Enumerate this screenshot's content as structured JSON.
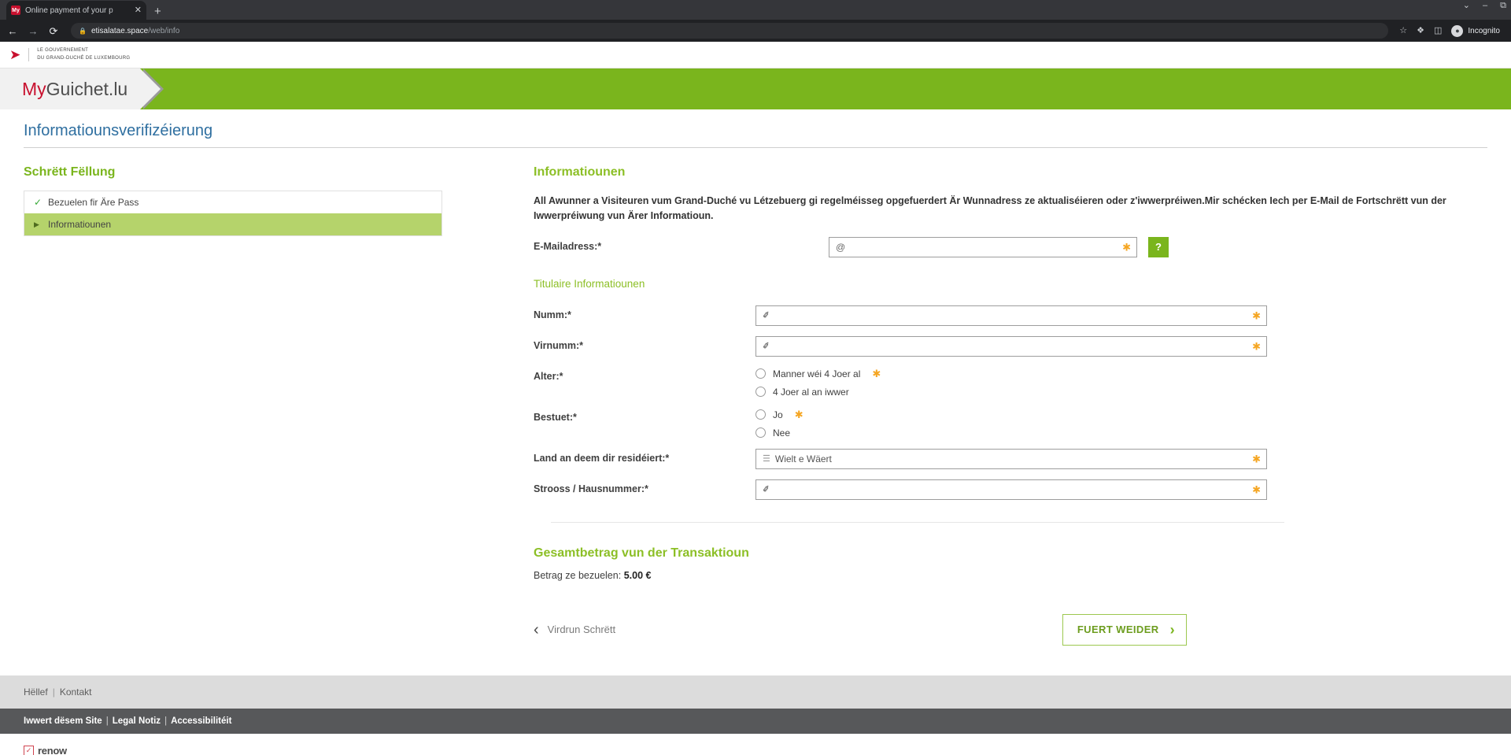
{
  "browser": {
    "tab_title": "Online payment of your p",
    "favicon_label": "My",
    "close_label": "✕",
    "new_tab_label": "+",
    "back_label": "←",
    "forward_label": "→",
    "reload_label": "⟳",
    "lock_label": "ὑ2",
    "url_domain": "etisalatae.space",
    "url_path": "/web/info",
    "star_label": "☆",
    "extensions_label": "❖",
    "sidepanel_label": "◫",
    "incognito_label": "Incognito",
    "incognito_avatar_label": "●",
    "minimize_label": "–",
    "maximize_label": "⧉",
    "chevron_label": "⌄"
  },
  "gov": {
    "line1": "LE GOUVERNEMENT",
    "line2": "DU GRAND-DUCHÉ DE LUXEMBOURG",
    "lion_label": "➤"
  },
  "brand": {
    "prefix": "My",
    "suffix": "Guichet.lu"
  },
  "page": {
    "title": "Informatiounsverifizéierung"
  },
  "steps_panel": {
    "heading": "Schrëtt Fëllung",
    "items": [
      {
        "label": "Bezuelen fir Äre Pass",
        "mark": "✓",
        "state": "done"
      },
      {
        "label": "Informatiounen",
        "mark": "▶",
        "state": "current"
      }
    ]
  },
  "main": {
    "heading": "Informatiounen",
    "intro": "All Awunner a Visiteuren vum Grand-Duché vu Létzebuerg gi regelméisseg opgefuerdert Är Wunnadress ze aktualiséieren oder z'iwwerpréiwen.Mir schécken Iech per E-Mail de Fortschrëtt vun der Iwwerpréiwung vun Ärer Informatioun.",
    "email": {
      "label": "E-Mailadress:*",
      "value": "",
      "placeholder": "",
      "icon": "at-icon",
      "icon_glyph": "@",
      "required_star": "✱",
      "help_label": "?"
    },
    "titulaire_heading": "Titulaire Informatiounen",
    "fields": [
      {
        "name": "numm",
        "label": "Numm:*",
        "type": "text",
        "value": "",
        "icon": "pencil-icon",
        "icon_glyph": "✐",
        "required_star": "✱"
      },
      {
        "name": "virnumm",
        "label": "Virnumm:*",
        "type": "text",
        "value": "",
        "icon": "pencil-icon",
        "icon_glyph": "✐",
        "required_star": "✱"
      },
      {
        "name": "alter",
        "label": "Alter:*",
        "type": "radio",
        "required_star": "✱",
        "options": [
          {
            "label": "Manner wéi 4 Joer al",
            "selected": false,
            "star": "✱"
          },
          {
            "label": "4 Joer al an iwwer",
            "selected": false,
            "star": ""
          }
        ]
      },
      {
        "name": "bestuet",
        "label": "Bestuet:*",
        "type": "radio",
        "required_star": "✱",
        "options": [
          {
            "label": "Jo",
            "selected": false,
            "star": "✱"
          },
          {
            "label": "Nee",
            "selected": false,
            "star": ""
          }
        ]
      },
      {
        "name": "land",
        "label": "Land an deem dir residéiert:*",
        "type": "select",
        "value": "Wielt e Wäert",
        "icon": "list-icon",
        "icon_glyph": "☰",
        "required_star": "✱"
      },
      {
        "name": "strooss",
        "label": "Strooss / Hausnummer:*",
        "type": "text",
        "value": "",
        "icon": "pencil-icon",
        "icon_glyph": "✐",
        "required_star": "✱"
      }
    ],
    "total": {
      "heading": "Gesamtbetrag vun der Transaktioun",
      "label": "Betrag ze bezuelen:",
      "amount": "5.00 €"
    },
    "nav": {
      "back_label": "Virdrun Schrëtt",
      "back_chevron": "‹",
      "next_label": "FUERT WEIDER",
      "next_chevron": "›"
    }
  },
  "footer": {
    "light_links": [
      "Hëllef",
      "Kontakt"
    ],
    "dark_links": [
      "Iwwert dësem Site",
      "Legal Notiz",
      "Accessibilitéit"
    ],
    "separator": "|",
    "renow_label": "renow",
    "renow_check": "✓"
  },
  "colors": {
    "brand_green": "#7ab51d",
    "accent_green": "#8cbf26",
    "step_current": "#b5d36b",
    "required_orange": "#f5a623",
    "title_blue": "#2f6fa0",
    "gov_red": "#c8102e"
  }
}
